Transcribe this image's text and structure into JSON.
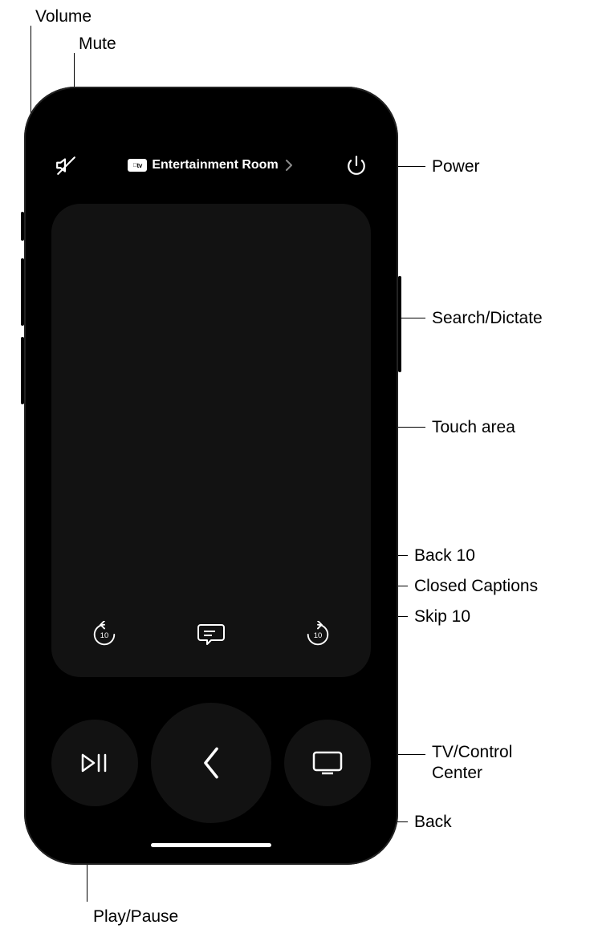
{
  "device_label": "Entertainment Room",
  "tv_badge_text": "tv",
  "callouts": {
    "volume": "Volume",
    "mute": "Mute",
    "power": "Power",
    "search_dictate": "Search/Dictate",
    "touch_area": "Touch area",
    "back_10": "Back 10",
    "closed_captions": "Closed Captions",
    "skip_10": "Skip 10",
    "tv_control_center": "TV/Control\nCenter",
    "back": "Back",
    "play_pause": "Play/Pause"
  },
  "icons": {
    "mute": "mute-icon",
    "power": "power-icon",
    "back10": "back-10-icon",
    "cc": "closed-captions-icon",
    "skip10": "skip-10-icon",
    "playpause": "play-pause-icon",
    "back": "chevron-left-icon",
    "tv": "tv-icon",
    "chevron_right": "chevron-right-icon"
  }
}
